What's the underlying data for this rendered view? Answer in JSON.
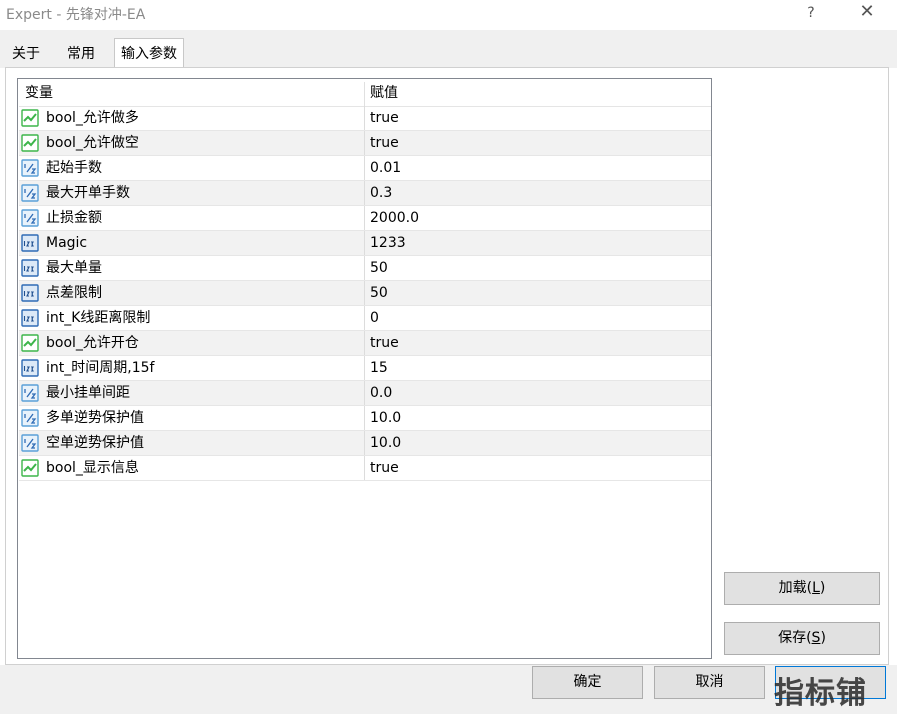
{
  "window": {
    "title": "Expert - 先锋对冲-EA",
    "help_label": "?",
    "close_label": "✕"
  },
  "tabs": [
    {
      "label": "关于",
      "active": false
    },
    {
      "label": "常用",
      "active": false
    },
    {
      "label": "输入参数",
      "active": true
    }
  ],
  "grid": {
    "columns": [
      "变量",
      "赋值"
    ],
    "rows": [
      {
        "icon": "boolean-icon",
        "name": "bool_允许做多",
        "value": "true"
      },
      {
        "icon": "double-icon",
        "name": "bool_允许做空",
        "value": "true",
        "icon_override": "boolean-icon"
      },
      {
        "icon": "double-icon",
        "name": "起始手数",
        "value": "0.01"
      },
      {
        "icon": "double-icon",
        "name": "最大开单手数",
        "value": "0.3"
      },
      {
        "icon": "double-icon",
        "name": "止损金额",
        "value": "2000.0"
      },
      {
        "icon": "integer-icon",
        "name": "Magic",
        "value": "1233"
      },
      {
        "icon": "integer-icon",
        "name": "最大单量",
        "value": "50"
      },
      {
        "icon": "integer-icon",
        "name": "点差限制",
        "value": "50"
      },
      {
        "icon": "integer-icon",
        "name": "int_K线距离限制",
        "value": "0"
      },
      {
        "icon": "boolean-icon",
        "name": "bool_允许开仓",
        "value": "true"
      },
      {
        "icon": "integer-icon",
        "name": "int_时间周期,15f",
        "value": "15"
      },
      {
        "icon": "double-icon",
        "name": "最小挂单间距",
        "value": "0.0"
      },
      {
        "icon": "double-icon",
        "name": "多单逆势保护值",
        "value": "10.0"
      },
      {
        "icon": "double-icon",
        "name": "空单逆势保护值",
        "value": "10.0"
      },
      {
        "icon": "boolean-icon",
        "name": "bool_显示信息",
        "value": "true"
      }
    ]
  },
  "buttons": {
    "load": {
      "label": "加载(",
      "key": "L",
      "end": ")"
    },
    "save": {
      "label": "保存(",
      "key": "S",
      "end": ")"
    },
    "ok": "确定",
    "cancel": "取消"
  },
  "watermark": "指标铺",
  "colors": {
    "boolean_icon": "#3cb54a",
    "double_icon": "#5aa0d8",
    "integer_icon": "#2e6bb5"
  }
}
